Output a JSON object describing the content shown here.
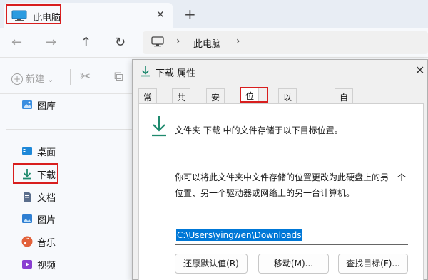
{
  "explorer": {
    "tab": {
      "title": "此电脑",
      "close_glyph": "✕",
      "new_tab_glyph": "+"
    },
    "nav": {
      "back": "←",
      "forward": "→",
      "up": "↑",
      "refresh": "↻"
    },
    "address": {
      "chev1": "›",
      "location": "此电脑",
      "chev2": "›"
    },
    "toolbar": {
      "new_label": "新建",
      "new_plus": "+",
      "new_chevron": "⌄",
      "cut_glyph": "✂",
      "copy_glyph": "⧉"
    },
    "sidebar": {
      "items": [
        {
          "label": "图库",
          "icon": "gallery-icon"
        },
        {
          "label": "桌面",
          "icon": "desktop-icon"
        },
        {
          "label": "下载",
          "icon": "download-icon"
        },
        {
          "label": "文档",
          "icon": "document-icon"
        },
        {
          "label": "图片",
          "icon": "pictures-icon"
        },
        {
          "label": "音乐",
          "icon": "music-icon"
        },
        {
          "label": "视频",
          "icon": "video-icon"
        }
      ]
    }
  },
  "dialog": {
    "title": "下载 属性",
    "close_glyph": "✕",
    "tabs": [
      "常规",
      "共享",
      "安全",
      "位置",
      "以前的版本",
      "自定义"
    ],
    "active_tab": "位置",
    "description": "文件夹 下载 中的文件存储于以下目标位置。",
    "info_line1": "你可以将此文件夹中文件存储的位置更改为此硬盘上的另一个",
    "info_line2": "位置、另一个驱动器或网络上的另一台计算机。",
    "path_value": "C:\\Users\\yingwen\\Downloads",
    "buttons": {
      "restore": "还原默认值(R)",
      "move": "移动(M)...",
      "find_target": "查找目标(F)..."
    }
  },
  "colors": {
    "highlight_box": "#d81e1e",
    "download_green": "#1f8a6e",
    "selection": "#0078d7"
  }
}
